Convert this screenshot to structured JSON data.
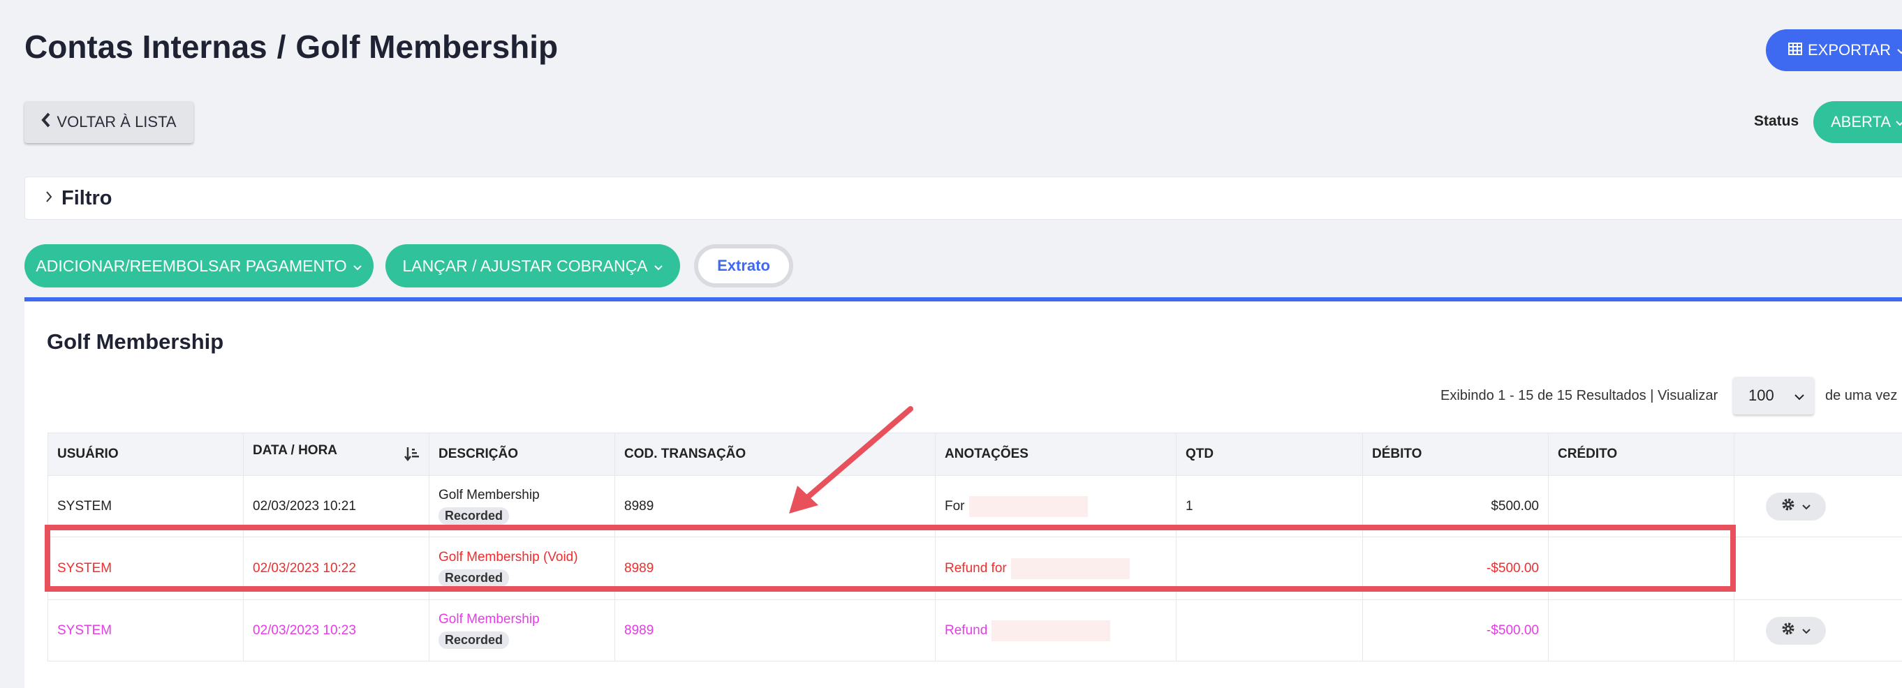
{
  "header": {
    "title_part1": "Contas Internas",
    "title_separator": "/",
    "title_part2": "Golf Membership",
    "export_label": "EXPORTAR",
    "back_label": "VOLTAR À LISTA",
    "status_label": "Status",
    "status_value": "ABERTA"
  },
  "filter": {
    "title": "Filtro"
  },
  "actions": {
    "add_refund_label": "ADICIONAR/REEMBOLSAR PAGAMENTO",
    "post_adjust_label": "LANÇAR / AJUSTAR COBRANÇA",
    "statement_label": "Extrato"
  },
  "card": {
    "title": "Golf Membership",
    "results_text": "Exibindo 1 - 15 de 15 Resultados |  Visualizar",
    "per_page_value": "100",
    "per_page_suffix": "de uma vez"
  },
  "table": {
    "columns": [
      "USUÁRIO",
      "DATA / HORA",
      "DESCRIÇÃO",
      "COD. TRANSAÇÃO",
      "ANOTAÇÕES",
      "QTD",
      "DÉBITO",
      "CRÉDITO",
      ""
    ],
    "rows": [
      {
        "user": "SYSTEM",
        "datetime": "02/03/2023 10:21",
        "description": "Golf Membership",
        "badge": "Recorded",
        "code": "8989",
        "notes": "For",
        "qty": "1",
        "debit": "$500.00",
        "credit": ""
      },
      {
        "user": "SYSTEM",
        "datetime": "02/03/2023 10:22",
        "description": "Golf Membership (Void)",
        "badge": "Recorded",
        "code": "8989",
        "notes": "Refund for",
        "qty": "",
        "debit": "-$500.00",
        "credit": ""
      },
      {
        "user": "SYSTEM",
        "datetime": "02/03/2023 10:23",
        "description": "Golf Membership",
        "badge": "Recorded",
        "code": "8989",
        "notes": "Refund",
        "qty": "",
        "debit": "-$500.00",
        "credit": ""
      }
    ]
  },
  "colors": {
    "primary_blue": "#3e6af2",
    "green": "#2fc29b",
    "void_red": "#ee2e2e",
    "refund_magenta": "#e63ce6",
    "annotation_red": "#e8505b"
  },
  "icons": [
    "table-icon",
    "chevron-down-icon",
    "chevron-left-icon",
    "chevron-right-icon",
    "sort-icon",
    "gear-icon",
    "arrow-annotation"
  ]
}
